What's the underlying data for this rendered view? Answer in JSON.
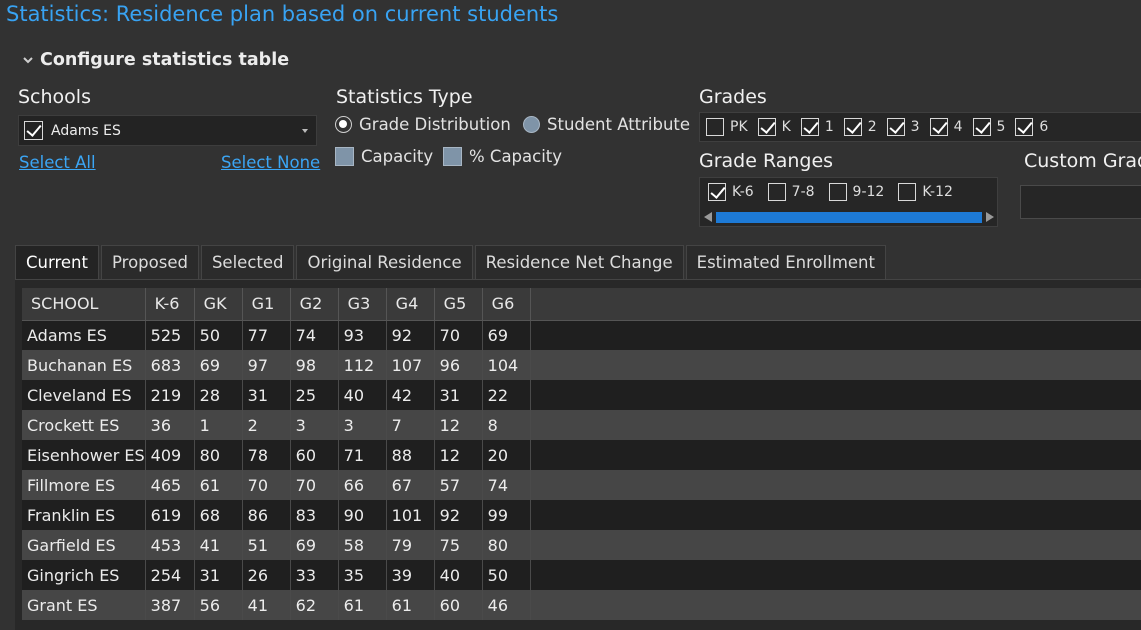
{
  "title": "Statistics: Residence plan based on current students",
  "config_label": "Configure statistics table",
  "schools": {
    "label": "Schools",
    "selected": "Adams ES",
    "select_all": "Select All",
    "select_none": "Select None"
  },
  "statistics_type": {
    "label": "Statistics Type",
    "grade_distribution": "Grade Distribution",
    "student_attribute": "Student Attribute",
    "capacity": "Capacity",
    "pct_capacity": "% Capacity"
  },
  "grades": {
    "label": "Grades",
    "items": [
      {
        "label": "PK",
        "checked": false
      },
      {
        "label": "K",
        "checked": true
      },
      {
        "label": "1",
        "checked": true
      },
      {
        "label": "2",
        "checked": true
      },
      {
        "label": "3",
        "checked": true
      },
      {
        "label": "4",
        "checked": true
      },
      {
        "label": "5",
        "checked": true
      },
      {
        "label": "6",
        "checked": true
      }
    ]
  },
  "grade_ranges": {
    "label": "Grade Ranges",
    "items": [
      {
        "label": "K-6",
        "checked": true
      },
      {
        "label": "7-8",
        "checked": false
      },
      {
        "label": "9-12",
        "checked": false
      },
      {
        "label": "K-12",
        "checked": false
      }
    ]
  },
  "custom_grades_label": "Custom Grades",
  "tabs": [
    "Current",
    "Proposed",
    "Selected",
    "Original Residence",
    "Residence Net Change",
    "Estimated Enrollment"
  ],
  "table": {
    "columns": [
      "SCHOOL",
      "K-6",
      "GK",
      "G1",
      "G2",
      "G3",
      "G4",
      "G5",
      "G6"
    ],
    "rows": [
      [
        "Adams ES",
        "525",
        "50",
        "77",
        "74",
        "93",
        "92",
        "70",
        "69"
      ],
      [
        "Buchanan ES",
        "683",
        "69",
        "97",
        "98",
        "112",
        "107",
        "96",
        "104"
      ],
      [
        "Cleveland ES",
        "219",
        "28",
        "31",
        "25",
        "40",
        "42",
        "31",
        "22"
      ],
      [
        "Crockett ES",
        "36",
        "1",
        "2",
        "3",
        "3",
        "7",
        "12",
        "8"
      ],
      [
        "Eisenhower ES",
        "409",
        "80",
        "78",
        "60",
        "71",
        "88",
        "12",
        "20"
      ],
      [
        "Fillmore ES",
        "465",
        "61",
        "70",
        "70",
        "66",
        "67",
        "57",
        "74"
      ],
      [
        "Franklin ES",
        "619",
        "68",
        "86",
        "83",
        "90",
        "101",
        "92",
        "99"
      ],
      [
        "Garfield ES",
        "453",
        "41",
        "51",
        "69",
        "58",
        "79",
        "75",
        "80"
      ],
      [
        "Gingrich ES",
        "254",
        "31",
        "26",
        "33",
        "35",
        "39",
        "40",
        "50"
      ],
      [
        "Grant ES",
        "387",
        "56",
        "41",
        "62",
        "61",
        "61",
        "60",
        "46"
      ]
    ]
  }
}
